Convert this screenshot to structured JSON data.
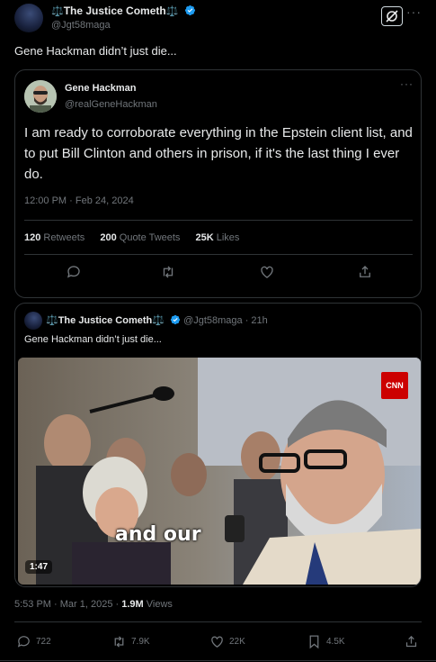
{
  "post": {
    "author_name": "The Justice Cometh",
    "author_scales": "⚖️",
    "author_handle": "@Jgt58maga",
    "text": "Gene Hackman didn’t just die...",
    "posted": "5:53 PM · Mar 1, 2025 · ",
    "views_count": "1.9M",
    "views_label": " Views",
    "actions": {
      "replies": "722",
      "reposts": "7.9K",
      "likes": "22K",
      "bookmarks": "4.5K"
    }
  },
  "embedded_tweet": {
    "name": "Gene Hackman",
    "handle": "@realGeneHackman",
    "text": "I am ready to corroborate everything in the Epstein client list, and to put Bill Clinton and others in prison, if it's the last thing I ever do.",
    "timestamp": "12:00 PM · Feb 24, 2024",
    "stats": [
      {
        "count": "120",
        "label": "Retweets"
      },
      {
        "count": "200",
        "label": "Quote Tweets"
      },
      {
        "count": "25K",
        "label": "Likes"
      }
    ]
  },
  "quoted": {
    "name": "The Justice Cometh",
    "scales": "⚖️",
    "handle_time": "@Jgt58maga · 21h",
    "text": "Gene Hackman didn’t just die...",
    "video": {
      "caption": "and our",
      "duration": "1:47",
      "logo": "CNN"
    }
  },
  "icons": {
    "more": "more-icon",
    "grok": "grok-icon",
    "verified": "verified-badge-icon",
    "reply": "reply-icon",
    "repost": "repost-icon",
    "like": "like-icon",
    "bookmark": "bookmark-icon",
    "share": "share-icon"
  },
  "colors": {
    "background": "#000000",
    "text": "#e7e9ea",
    "muted": "#71767b",
    "border": "#2f3336",
    "verified": "#1d9bf0"
  }
}
